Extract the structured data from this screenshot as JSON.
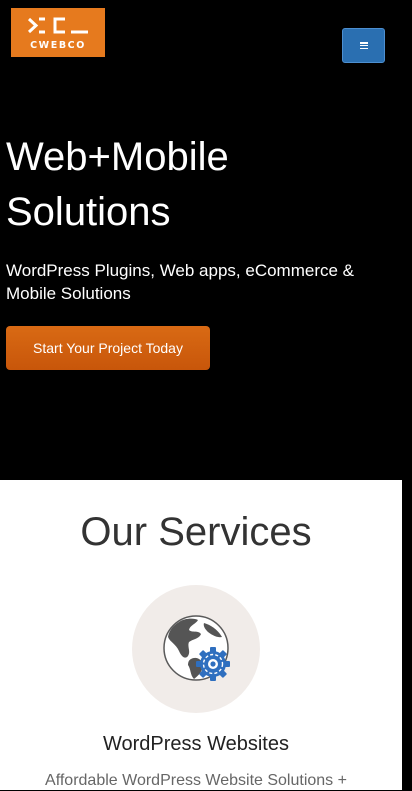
{
  "brand": {
    "name": "CWEBCO",
    "logo_color": "#e67a1e"
  },
  "header": {
    "menu_icon": "hamburger-icon",
    "menu_color": "#2a6fb1"
  },
  "hero": {
    "title_line1": "Web+Mobile",
    "title_line2": "Solutions",
    "subtitle": "WordPress Plugins, Web apps, eCommerce & Mobile Solutions",
    "cta_label": "Start Your Project Today",
    "cta_color": "#d9641a"
  },
  "services": {
    "heading": "Our Services",
    "items": [
      {
        "icon": "globe-gear-icon",
        "title": "WordPress Websites",
        "description": "Affordable WordPress Website Solutions +"
      }
    ]
  }
}
